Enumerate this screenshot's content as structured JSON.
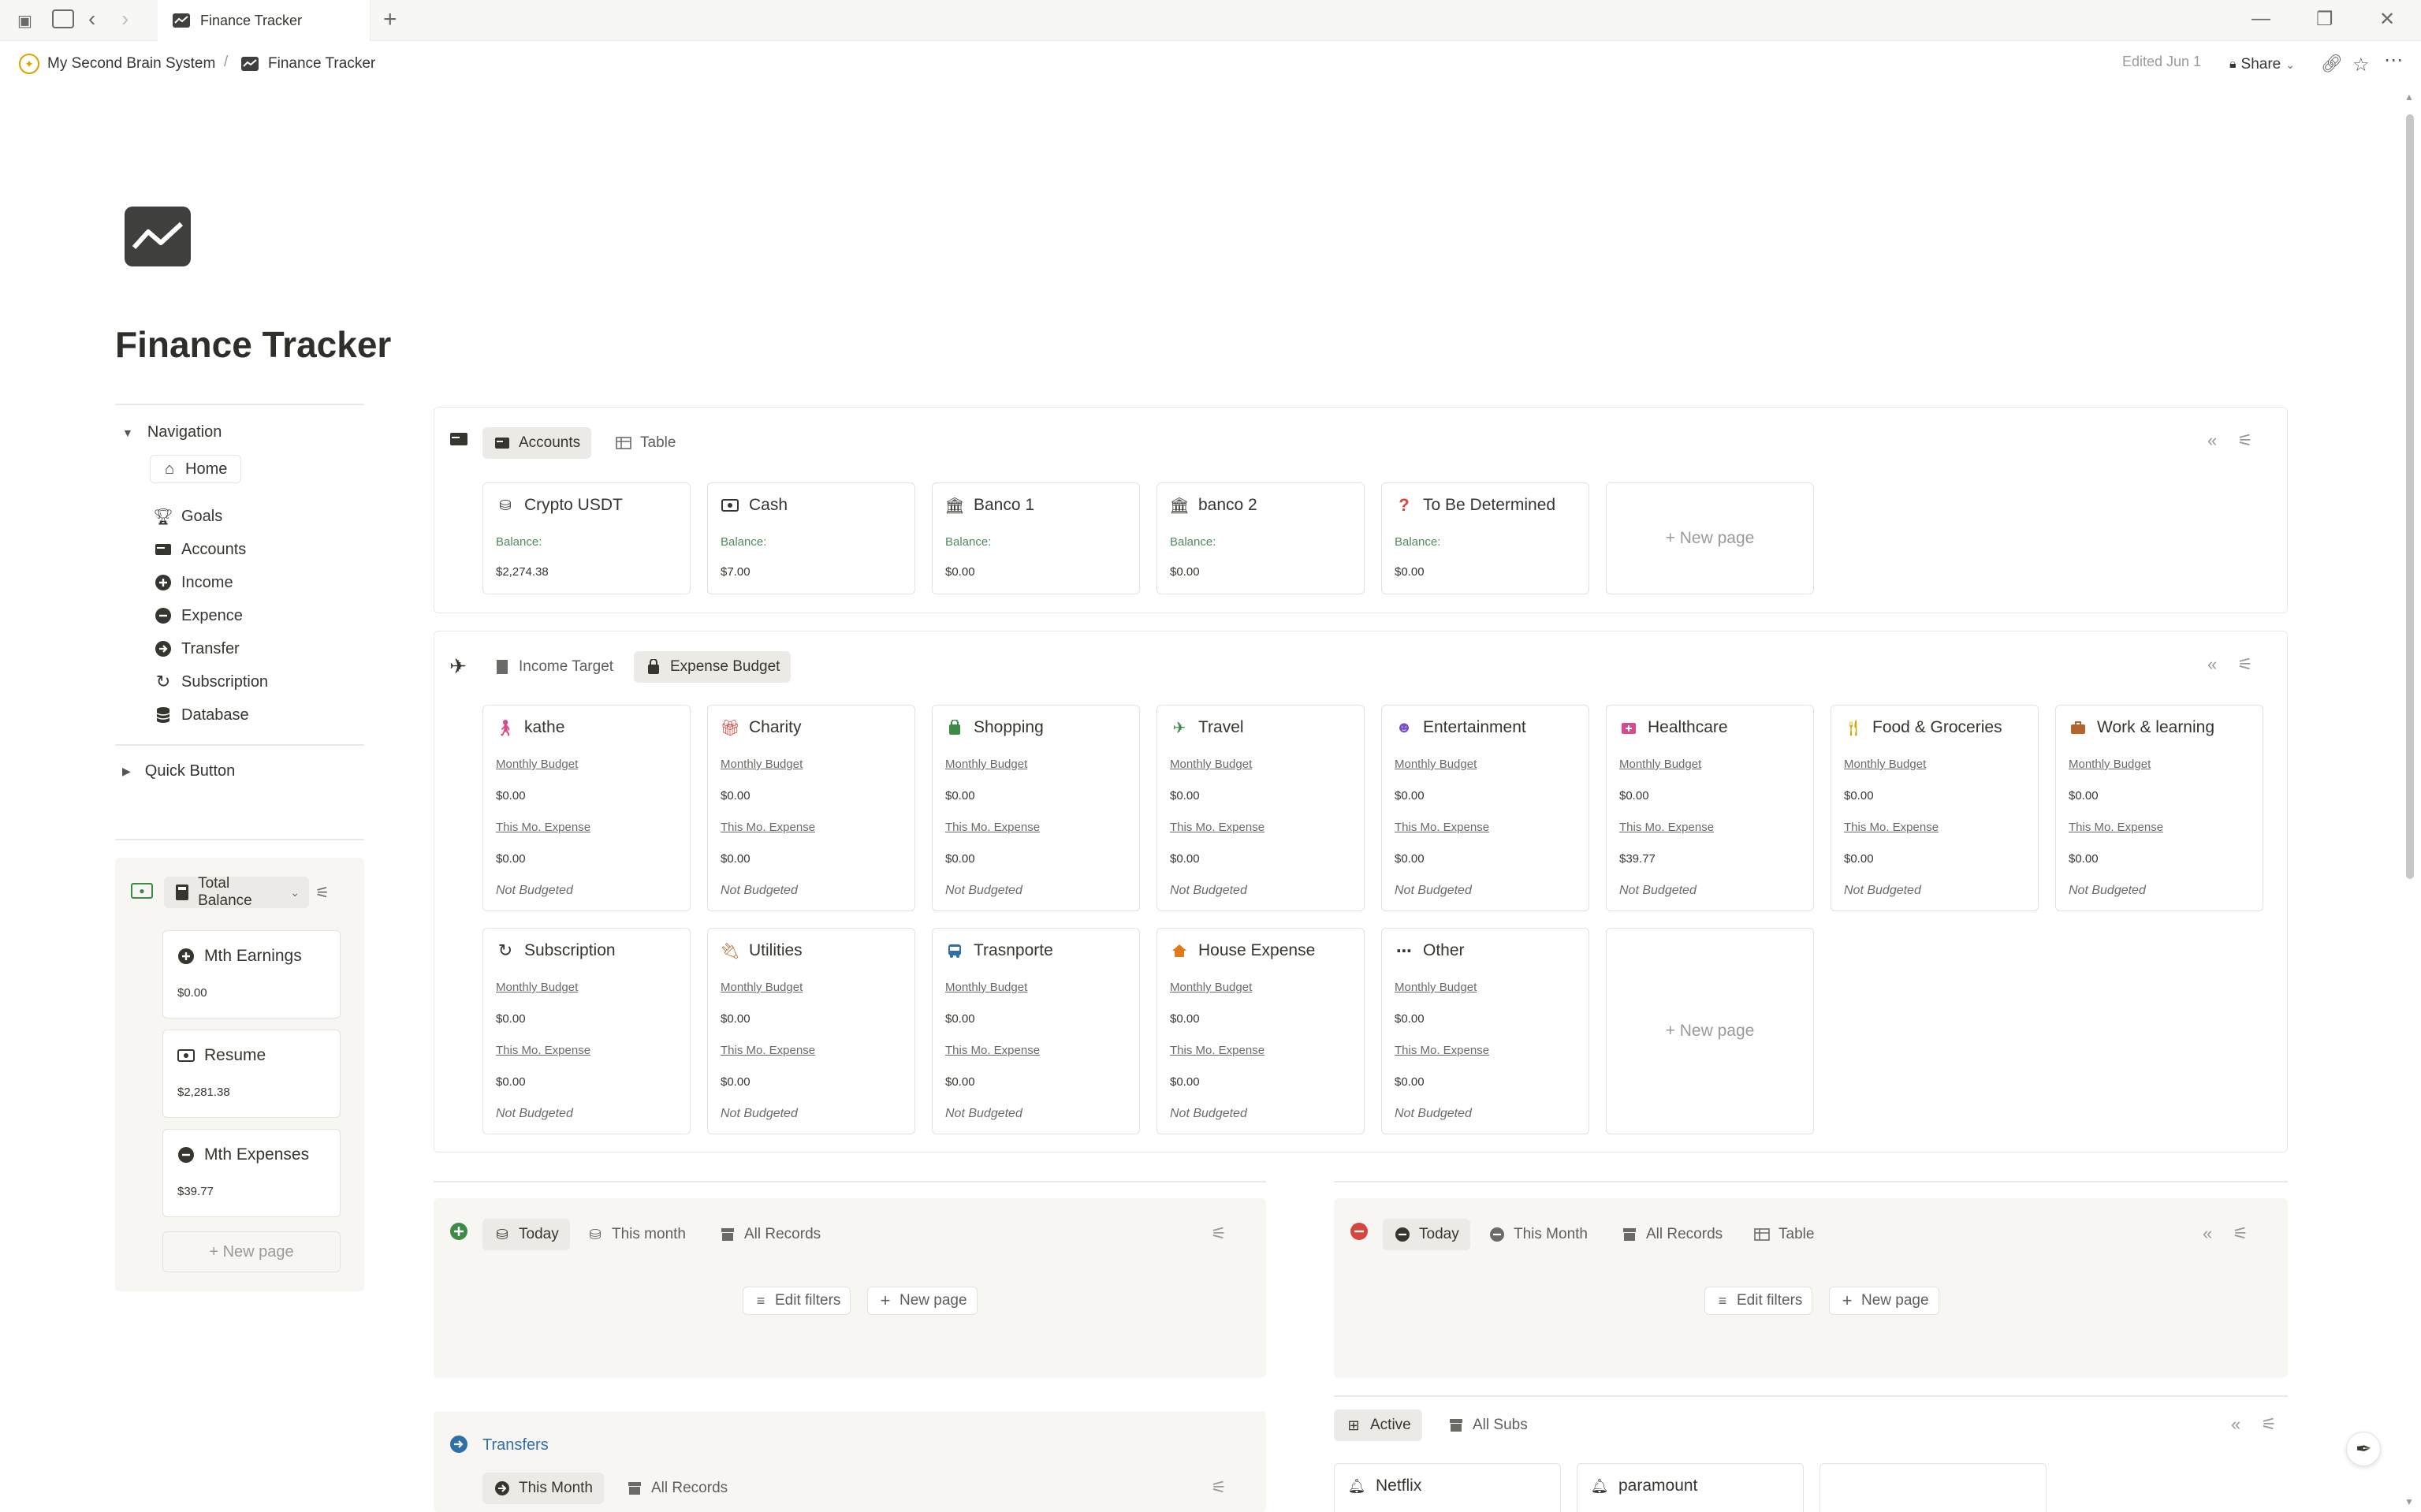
{
  "window": {
    "tab_title": "Finance Tracker",
    "new_tab": "+",
    "controls": {
      "minimize": "—",
      "restore": "❐",
      "close": "✕"
    }
  },
  "breadcrumb": {
    "workspace": "My Second Brain System",
    "separator": "/",
    "page": "Finance Tracker",
    "edited": "Edited Jun 1",
    "share_label": "Share"
  },
  "page": {
    "title": "Finance Tracker"
  },
  "navigation": {
    "toggle_label": "Navigation",
    "home": "Home",
    "items": [
      "Goals",
      "Accounts",
      "Income",
      "Expence",
      "Transfer",
      "Subscription",
      "Database"
    ],
    "quick_button": "Quick Button"
  },
  "balance_panel": {
    "view_label": "Total Balance",
    "cards": [
      {
        "title": "Mth Earnings",
        "value": "$0.00"
      },
      {
        "title": "Resume",
        "value": "$2,281.38"
      },
      {
        "title": "Mth Expenses",
        "value": "$39.77"
      }
    ],
    "new_page": "+ New page"
  },
  "accounts_section": {
    "tabs": [
      "Accounts",
      "Table"
    ],
    "balance_label": "Balance:",
    "cards": [
      {
        "title": "Crypto USDT",
        "value": "$2,274.38"
      },
      {
        "title": "Cash",
        "value": "$7.00"
      },
      {
        "title": "Banco 1",
        "value": "$0.00"
      },
      {
        "title": "banco 2",
        "value": "$0.00"
      },
      {
        "title": "To Be Determined",
        "value": "$0.00"
      }
    ],
    "new_page": "+ New page"
  },
  "budget_section": {
    "tabs": [
      "Income Target",
      "Expense Budget"
    ],
    "labels": {
      "monthly": "Monthly Budget",
      "expense": "This Mo. Expense",
      "status": "Not Budgeted"
    },
    "cards": [
      {
        "title": "kathe",
        "budget": "$0.00",
        "expense": "$0.00"
      },
      {
        "title": "Charity",
        "budget": "$0.00",
        "expense": "$0.00"
      },
      {
        "title": "Shopping",
        "budget": "$0.00",
        "expense": "$0.00"
      },
      {
        "title": "Travel",
        "budget": "$0.00",
        "expense": "$0.00"
      },
      {
        "title": "Entertainment",
        "budget": "$0.00",
        "expense": "$0.00"
      },
      {
        "title": "Healthcare",
        "budget": "$0.00",
        "expense": "$39.77"
      },
      {
        "title": "Food & Groceries",
        "budget": "$0.00",
        "expense": "$0.00"
      },
      {
        "title": "Work & learning",
        "budget": "$0.00",
        "expense": "$0.00"
      },
      {
        "title": "Subscription",
        "budget": "$0.00",
        "expense": "$0.00"
      },
      {
        "title": "Utilities",
        "budget": "$0.00",
        "expense": "$0.00"
      },
      {
        "title": "Trasnporte",
        "budget": "$0.00",
        "expense": "$0.00"
      },
      {
        "title": "House Expense",
        "budget": "$0.00",
        "expense": "$0.00"
      },
      {
        "title": "Other",
        "budget": "$0.00",
        "expense": "$0.00"
      }
    ],
    "new_page": "+ New page"
  },
  "income_records": {
    "tabs": [
      "Today",
      "This month",
      "All Records"
    ],
    "edit_filters": "Edit filters",
    "new_page": "New page"
  },
  "expense_records": {
    "tabs": [
      "Today",
      "This Month",
      "All Records",
      "Table"
    ],
    "edit_filters": "Edit filters",
    "new_page": "New page"
  },
  "transfers": {
    "title": "Transfers",
    "tabs": [
      "This Month",
      "All Records"
    ]
  },
  "subscriptions": {
    "tabs": [
      "Active",
      "All Subs"
    ],
    "cards": [
      "Netflix",
      "paramount"
    ]
  },
  "colors": {
    "accent_green": "#4f8a5e",
    "income_green": "#3e8b48",
    "expense_red": "#d9453d",
    "link_blue": "#2f6fa8"
  }
}
